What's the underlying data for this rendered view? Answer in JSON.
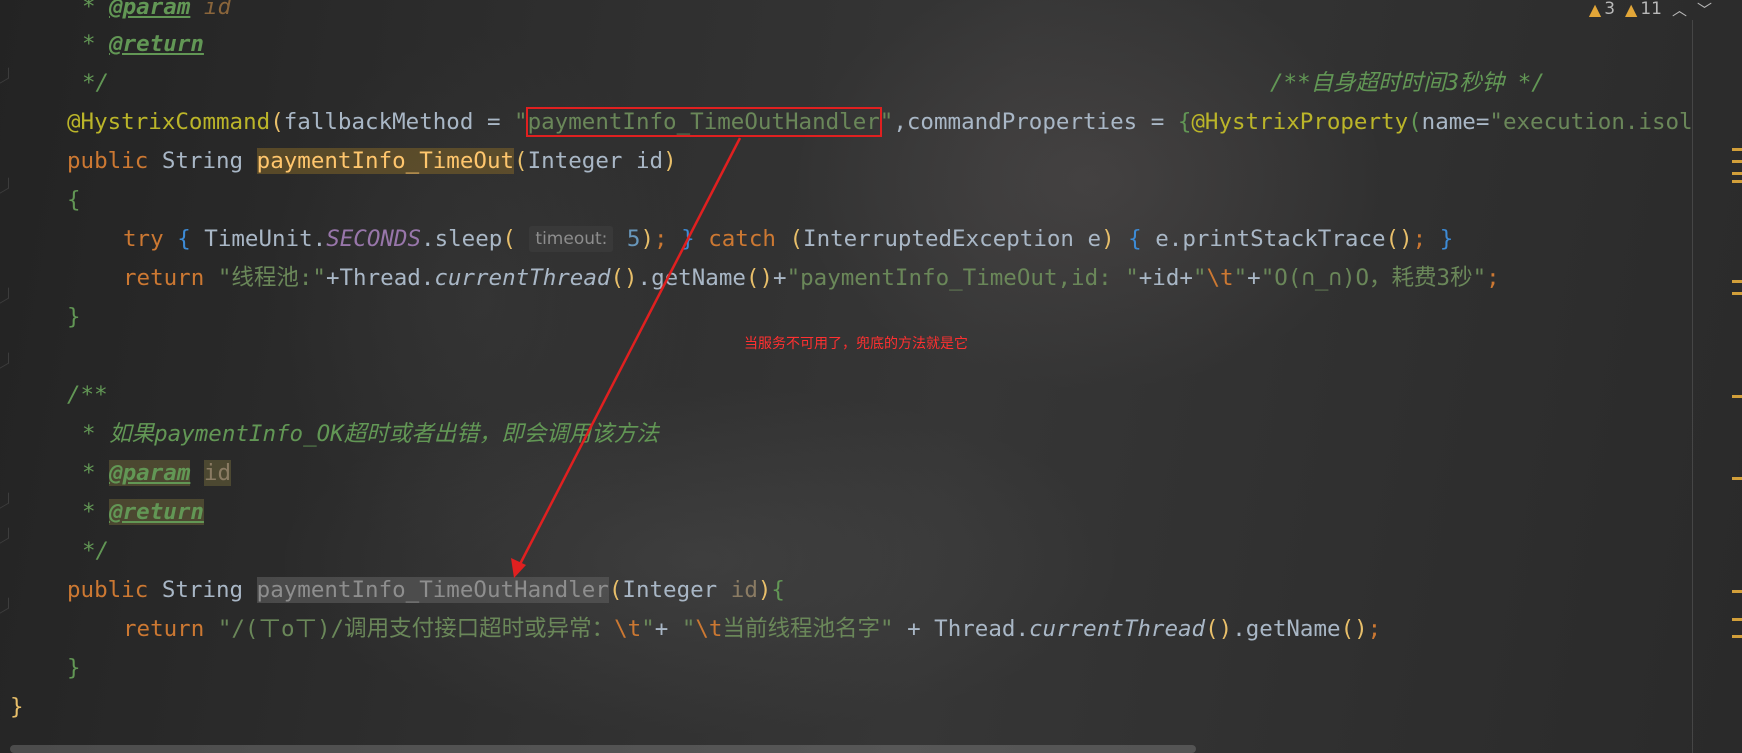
{
  "top_right": {
    "warnings_count": "3",
    "weak_warnings_count": "11",
    "warning_icon": "warning-triangle-icon",
    "up_icon": "chevron-up-icon",
    "down_icon": "chevron-down-icon"
  },
  "annotation": {
    "note": "当服务不可用了，兜底的方法就是它",
    "color": "#ff3030"
  },
  "lines": {
    "l1": {
      "star": "* ",
      "tag": "@param",
      "param": " id"
    },
    "l2": {
      "star": "* ",
      "tag": "@return"
    },
    "l3": {
      "end": "*/",
      "right_comment": "/**自身超时时间3秒钟 */"
    },
    "l4": {
      "ann": "@HystrixCommand",
      "open": "(",
      "code1": "fallbackMethod = ",
      "q1": "\"",
      "boxed": "paymentInfo_TimeOutHandler",
      "q2": "\"",
      "code2": ",commandProperties = ",
      "brace": "{",
      "ann2": "@HystrixProperty",
      "open2": "(",
      "code3": "name=",
      "str": "\"execution.isol"
    },
    "l5": {
      "kw": "public ",
      "type": "String ",
      "method": "paymentInfo_TimeOut",
      "open": "(",
      "params": "Integer id",
      "close": ")"
    },
    "l6": {
      "brace": "{"
    },
    "l7": {
      "kw": "try ",
      "b1": "{",
      "code1": " TimeUnit.",
      "field": "SECONDS",
      "code2": ".sleep",
      "open": "(",
      "hint": "timeout:",
      "num": " 5",
      "close": ")",
      "semi": "; ",
      "b2": "}",
      "kw2": " catch ",
      "open2": "(",
      "code3": "InterruptedException e",
      "close2": ")",
      "sp": " ",
      "b3": "{",
      "code4": " e.printStackTrace",
      "pp": "()",
      "semi2": "; ",
      "b4": "}"
    },
    "l8": {
      "kw": "return ",
      "s1": "\"线程池:\"",
      "code1": "+Thread.",
      "italic": "currentThread",
      "p1": "()",
      "code2": ".getName",
      "p2": "()",
      "code3": "+",
      "s2": "\"paymentInfo_TimeOut,id: \"",
      "code4": "+id+",
      "s3a": "\"",
      "esc": "\\t",
      "s3b": "\"",
      "code5": "+",
      "s4": "\"O(∩_∩)O，耗费3秒\"",
      "semi": ";"
    },
    "l9": {
      "brace": "}"
    },
    "l11": {
      "start": "/**"
    },
    "l12": {
      "text": "* 如果paymentInfo_OK超时或者出错，即会调用该方法"
    },
    "l13": {
      "star": "* ",
      "tag": "@param",
      "sp": " ",
      "param": "id"
    },
    "l14": {
      "star": "* ",
      "tag": "@return"
    },
    "l15": {
      "end": "*/"
    },
    "l16": {
      "kw": "public ",
      "type": "String ",
      "method": "paymentInfo_TimeOutHandler",
      "open": "(",
      "ptype": "Integer ",
      "pname": "id",
      "close": ")",
      "brace": "{"
    },
    "l17": {
      "kw": "return ",
      "s1": "\"/(ㄒoㄒ)/调用支付接口超时或异常：",
      "esc1": "\\t",
      "s1b": "\"",
      "code1": "+ ",
      "s2a": "\"",
      "esc2": "\\t",
      "s2b": "当前线程池名字\"",
      "code2": " + Thread.",
      "italic": "currentThread",
      "p1": "()",
      "code3": ".getName",
      "p2": "()",
      "semi": ";"
    },
    "l18": {
      "brace": "}"
    },
    "l19": {
      "brace": "}"
    }
  }
}
